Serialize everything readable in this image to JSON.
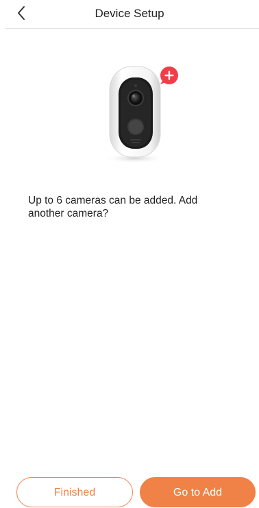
{
  "header": {
    "title": "Device Setup",
    "back_icon": "chevron-left-icon"
  },
  "illustration": {
    "device": "camera-illustration",
    "badge_icon": "plus-icon",
    "badge_color": "#ef3e4a"
  },
  "message": "Up to 6 cameras can be added. Add another camera?",
  "buttons": {
    "finished_label": "Finished",
    "go_to_add_label": "Go to Add"
  },
  "colors": {
    "accent": "#f08147",
    "text": "#222222",
    "divider": "#e3e3e3"
  }
}
